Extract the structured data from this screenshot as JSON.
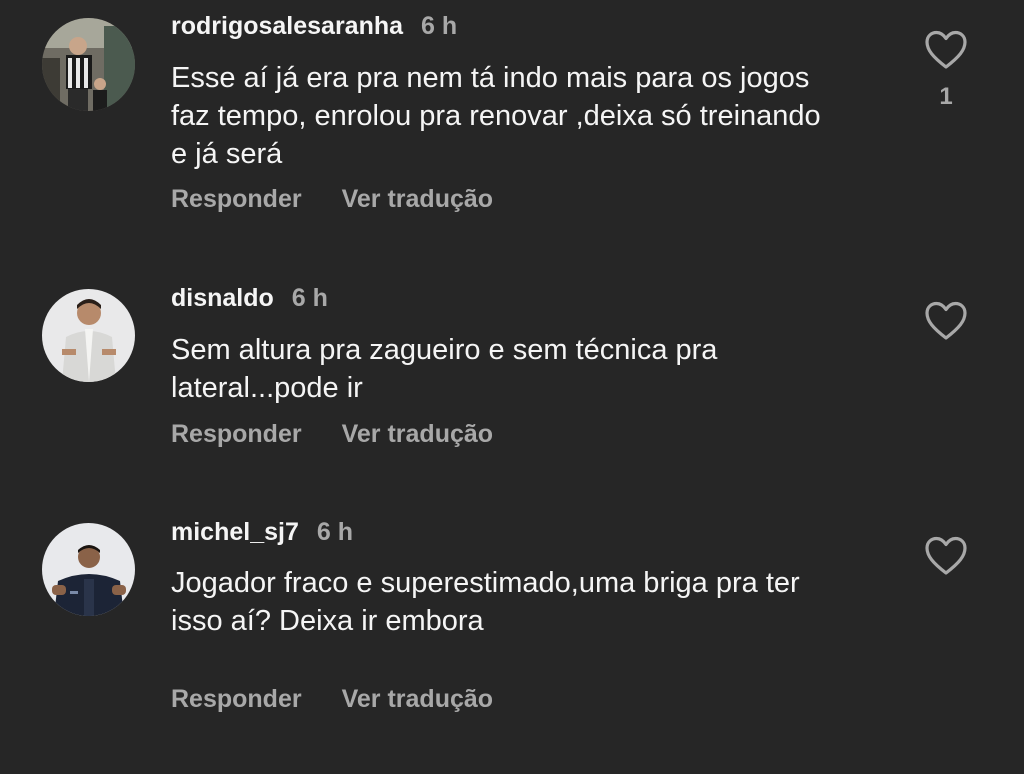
{
  "comments": [
    {
      "username": "rodrigosalesaranha",
      "time": "6 h",
      "lines": [
        "Esse aí já era pra nem tá indo mais para os jogos",
        "faz tempo, enrolou pra renovar ,deixa só treinando",
        "e já será"
      ],
      "reply_label": "Responder",
      "translate_label": "Ver tradução",
      "like_count": "1",
      "like_icon": "heart-outline-icon"
    },
    {
      "username": "disnaldo",
      "time": "6 h",
      "lines": [
        "Sem altura pra zagueiro e sem técnica pra",
        "lateral...pode ir"
      ],
      "reply_label": "Responder",
      "translate_label": "Ver tradução",
      "like_icon": "heart-outline-icon"
    },
    {
      "username": "michel_sj7",
      "time": "6 h",
      "lines": [
        "Jogador fraco e superestimado,uma briga pra ter",
        "isso aí? Deixa ir embora"
      ],
      "reply_label": "Responder",
      "translate_label": "Ver tradução",
      "like_icon": "heart-outline-icon"
    }
  ],
  "colors": {
    "background": "#262626",
    "primary_text": "#f5f5f5",
    "secondary_text": "#a8a8a8"
  }
}
